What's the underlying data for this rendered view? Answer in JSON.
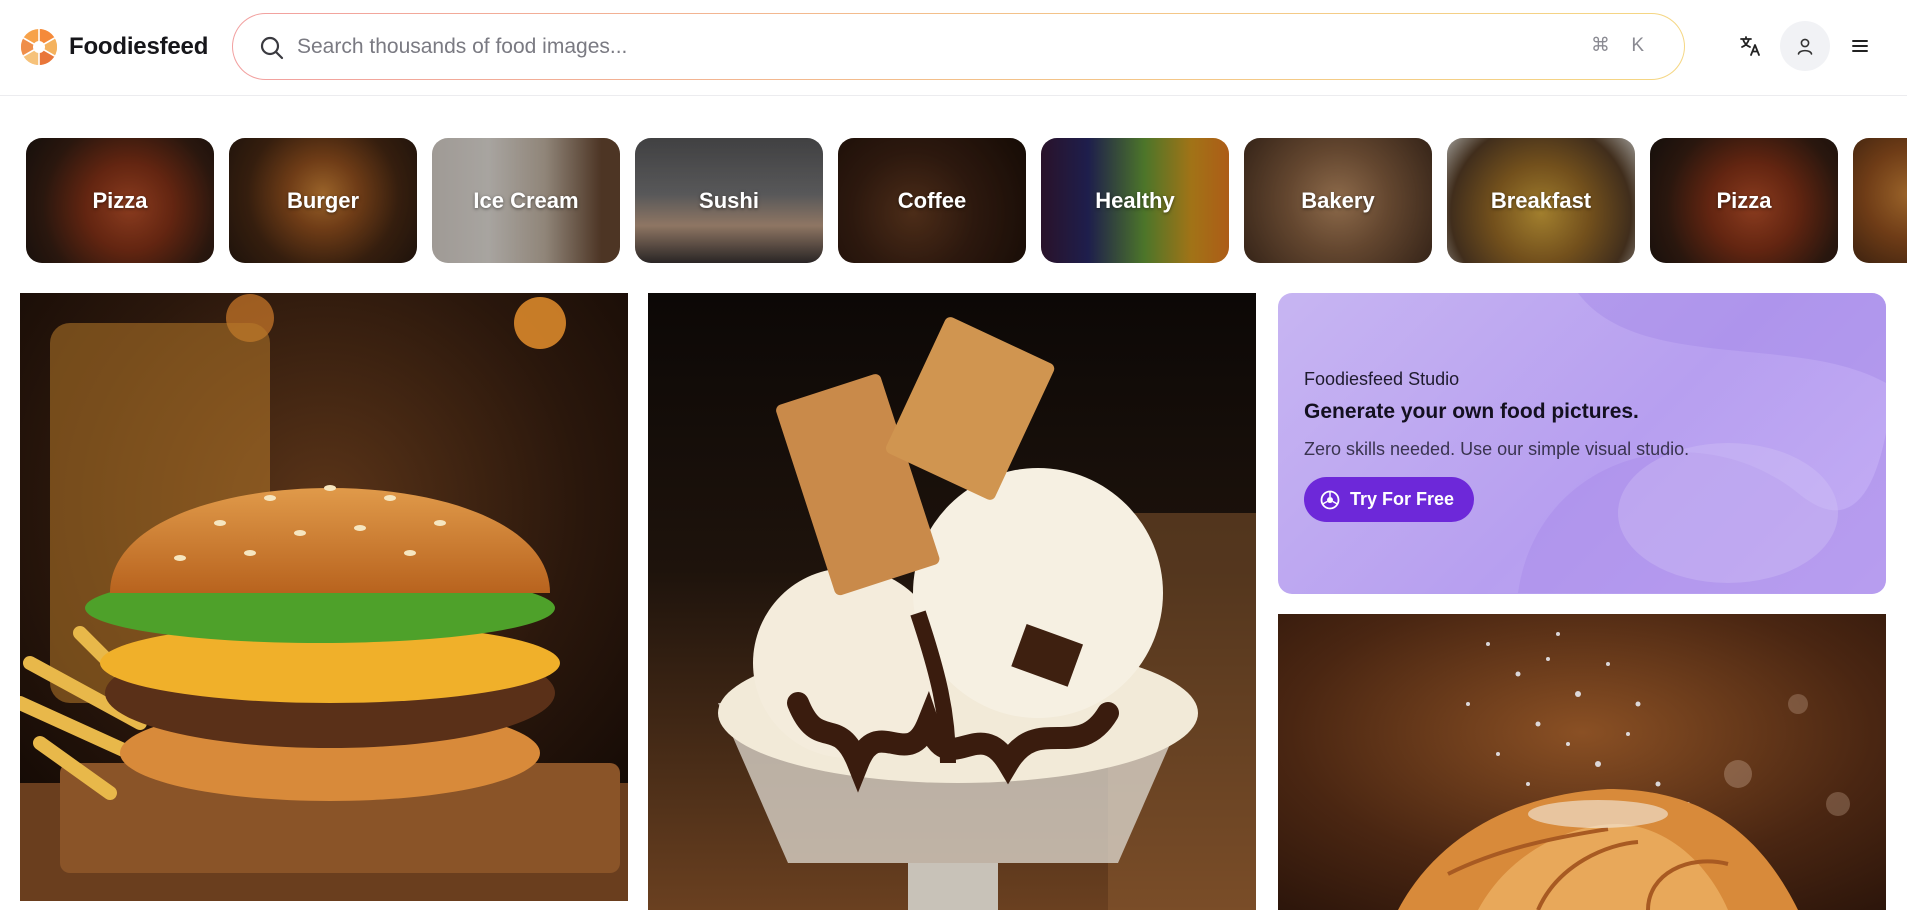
{
  "brand": {
    "name": "Foodiesfeed"
  },
  "search": {
    "placeholder": "Search thousands of food images...",
    "shortcut": "⌘ K"
  },
  "header_actions": [
    {
      "name": "translate-icon"
    },
    {
      "name": "user-icon"
    },
    {
      "name": "menu-icon"
    }
  ],
  "categories": [
    {
      "label": "Pizza"
    },
    {
      "label": "Burger"
    },
    {
      "label": "Ice Cream"
    },
    {
      "label": "Sushi"
    },
    {
      "label": "Coffee"
    },
    {
      "label": "Healthy"
    },
    {
      "label": "Bakery"
    },
    {
      "label": "Breakfast"
    },
    {
      "label": "Pizza"
    }
  ],
  "promo": {
    "eyebrow": "Foodiesfeed Studio",
    "title": "Generate your own food pictures.",
    "subtitle": "Zero skills needed. Use our simple visual studio.",
    "button_label": "Try For Free"
  },
  "colors": {
    "accent_purple": "#6d28d9",
    "search_gradient_start": "#f2a0a0",
    "search_gradient_end": "#f5d784"
  }
}
